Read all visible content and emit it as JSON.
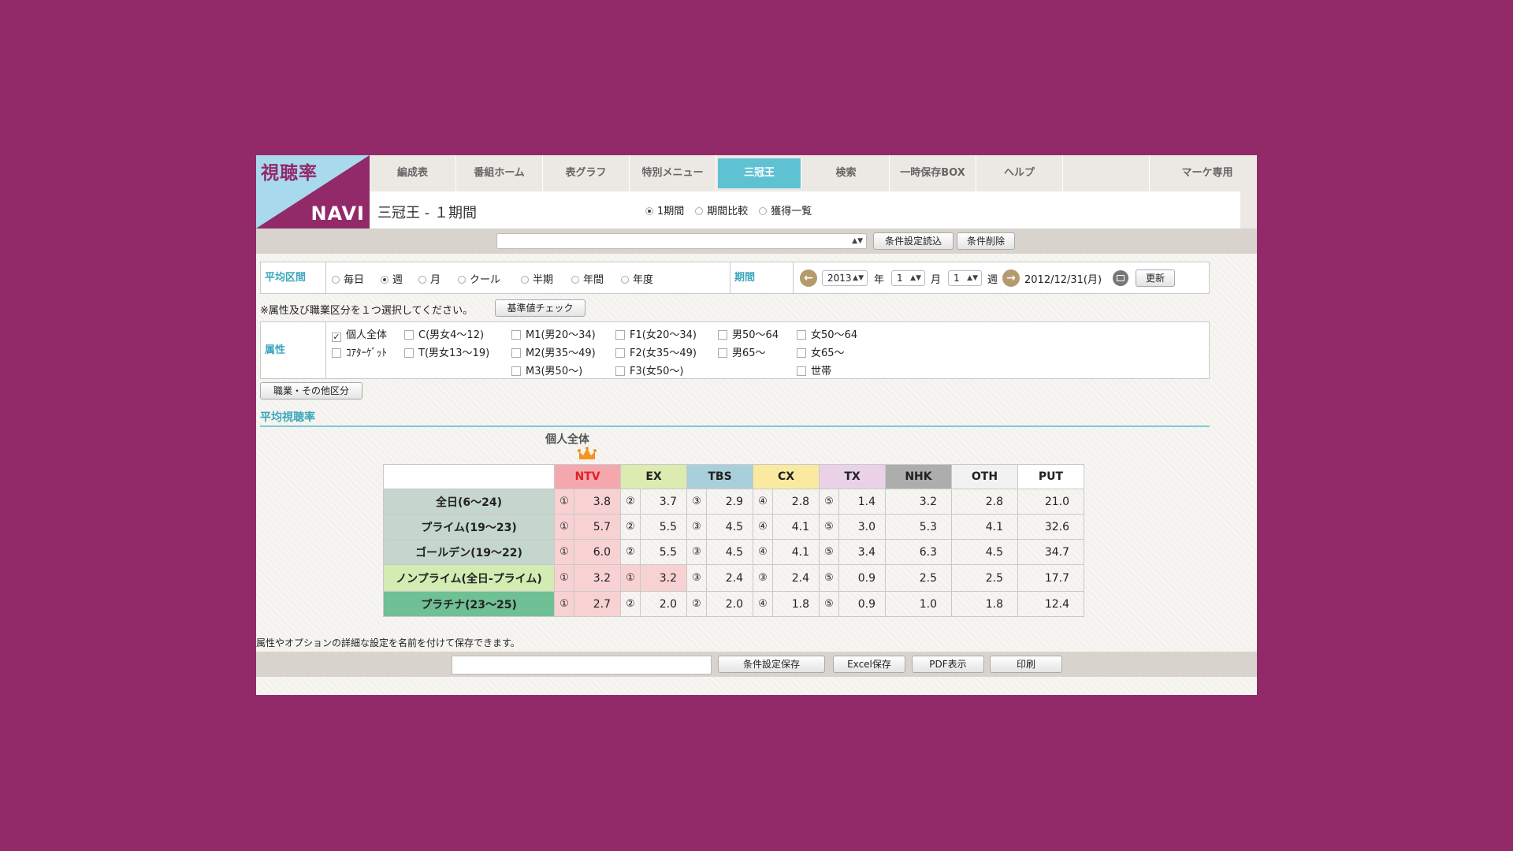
{
  "logo": {
    "top": "視聴率",
    "bottom": "NAVI"
  },
  "nav": {
    "tabs": [
      "編成表",
      "番組ホーム",
      "表グラフ",
      "特別メニュー",
      "三冠王",
      "検索",
      "一時保存BOX",
      "ヘルプ"
    ],
    "active": "三冠王",
    "right": "マーケ専用"
  },
  "page_title": "三冠王 - １期間",
  "modes": [
    {
      "label": "1期間",
      "selected": true
    },
    {
      "label": "期間比較",
      "selected": false
    },
    {
      "label": "獲得一覧",
      "selected": false
    }
  ],
  "toolbar": {
    "load_label": "条件設定読込",
    "delete_label": "条件削除"
  },
  "average": {
    "label": "平均区間",
    "options": [
      {
        "label": "毎日",
        "selected": false
      },
      {
        "label": "週",
        "selected": true
      },
      {
        "label": "月",
        "selected": false
      },
      {
        "label": "クール",
        "selected": false
      },
      {
        "label": "半期",
        "selected": false
      },
      {
        "label": "年間",
        "selected": false
      },
      {
        "label": "年度",
        "selected": false
      }
    ]
  },
  "period": {
    "label": "期間",
    "year": "2013",
    "year_unit": "年",
    "month": "1",
    "month_unit": "月",
    "week": "1",
    "week_unit": "週",
    "date": "2012/12/31(月)",
    "update_label": "更新"
  },
  "instruction": "※属性及び職業区分を１つ選択してください。",
  "baseline_label": "基準値チェック",
  "attributes": {
    "label": "属性",
    "col1": [
      {
        "label": "個人全体",
        "checked": true
      },
      {
        "label": "ｺｱﾀｰｹﾞｯﾄ",
        "checked": false
      }
    ],
    "col2": [
      {
        "label": "C(男女4～12)",
        "checked": false
      },
      {
        "label": "T(男女13～19)",
        "checked": false
      }
    ],
    "col3": [
      {
        "label": "M1(男20～34)",
        "checked": false
      },
      {
        "label": "M2(男35～49)",
        "checked": false
      },
      {
        "label": "M3(男50～)",
        "checked": false
      }
    ],
    "col4": [
      {
        "label": "F1(女20～34)",
        "checked": false
      },
      {
        "label": "F2(女35～49)",
        "checked": false
      },
      {
        "label": "F3(女50～)",
        "checked": false
      }
    ],
    "col5": [
      {
        "label": "男50～64",
        "checked": false
      },
      {
        "label": "男65～",
        "checked": false
      }
    ],
    "col6": [
      {
        "label": "女50～64",
        "checked": false
      },
      {
        "label": "女65～",
        "checked": false
      },
      {
        "label": "世帯",
        "checked": false
      }
    ]
  },
  "occupation_label": "職業・その他区分",
  "section_title": "平均視聴率",
  "chart_heading": "個人全体",
  "colors": {
    "NTV": "#f4a8ad",
    "EX": "#dcebb0",
    "TBS": "#a9cfdc",
    "CX": "#faeaa0",
    "TX": "#ead1e8",
    "NHK": "#adadad",
    "OTH": "#f2f2f2",
    "PUT": "#ffffff",
    "win": "#f8d2d3"
  },
  "table": {
    "channels": [
      "NTV",
      "EX",
      "TBS",
      "CX",
      "TX",
      "NHK",
      "OTH",
      "PUT"
    ],
    "rows": [
      {
        "label": "全日(6～24)",
        "color": "#c4d6ce",
        "ranks": [
          "①",
          "②",
          "③",
          "④",
          "⑤"
        ],
        "values": [
          "3.8",
          "3.7",
          "2.9",
          "2.8",
          "1.4",
          "3.2",
          "2.8",
          "21.0"
        ]
      },
      {
        "label": "プライム(19～23)",
        "color": "#c4d6ce",
        "ranks": [
          "①",
          "②",
          "③",
          "④",
          "⑤"
        ],
        "values": [
          "5.7",
          "5.5",
          "4.5",
          "4.1",
          "3.0",
          "5.3",
          "4.1",
          "32.6"
        ]
      },
      {
        "label": "ゴールデン(19～22)",
        "color": "#c4d6ce",
        "ranks": [
          "①",
          "②",
          "③",
          "④",
          "⑤"
        ],
        "values": [
          "6.0",
          "5.5",
          "4.5",
          "4.1",
          "3.4",
          "6.3",
          "4.5",
          "34.7"
        ]
      },
      {
        "label": "ノンプライム(全日-プライム)",
        "color": "#d2ecb2",
        "ranks": [
          "①",
          "①",
          "③",
          "③",
          "⑤"
        ],
        "values": [
          "3.2",
          "3.2",
          "2.4",
          "2.4",
          "0.9",
          "2.5",
          "2.5",
          "17.7"
        ]
      },
      {
        "label": "プラチナ(23～25)",
        "color": "#6fc095",
        "ranks": [
          "①",
          "②",
          "②",
          "④",
          "⑤"
        ],
        "values": [
          "2.7",
          "2.0",
          "2.0",
          "1.8",
          "0.9",
          "1.0",
          "1.8",
          "12.4"
        ]
      }
    ]
  },
  "footer": {
    "note": "属性やオプションの詳細な設定を名前を付けて保存できます。",
    "save_label": "条件設定保存",
    "excel_label": "Excel保存",
    "pdf_label": "PDF表示",
    "print_label": "印刷"
  }
}
